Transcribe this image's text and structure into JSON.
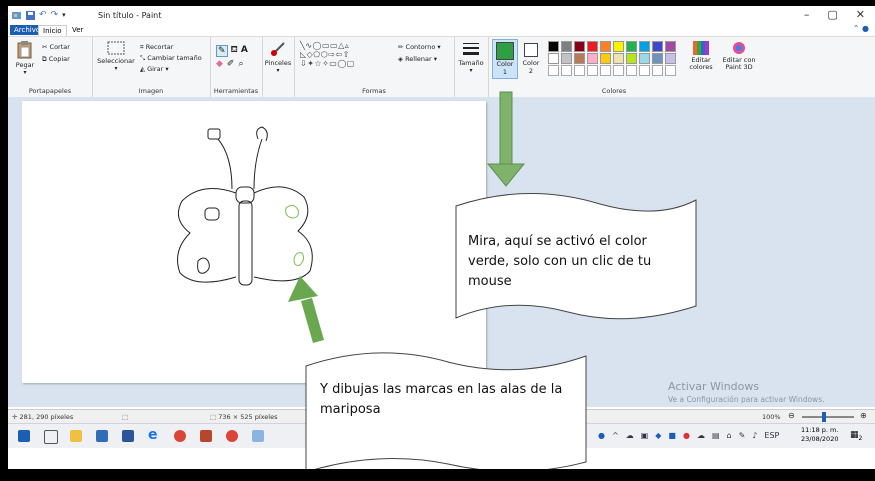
{
  "window": {
    "title": "Sin título - Paint",
    "minimize": "–",
    "maximize": "▢",
    "close": "✕"
  },
  "tabs": {
    "file": "Archivo",
    "home": "Inicio",
    "view": "Ver"
  },
  "ribbon": {
    "clipboard": {
      "paste": "Pegar",
      "cut": "Cortar",
      "copy": "Copiar",
      "label": "Portapapeles"
    },
    "image": {
      "select": "Seleccionar",
      "crop": "Recortar",
      "resize": "Cambiar tamaño",
      "rotate": "Girar ▾",
      "label": "Imagen"
    },
    "tools": {
      "label": "Herramientas",
      "text_tool": "A"
    },
    "brushes": {
      "label": "Pinceles"
    },
    "shapes": {
      "outline": "Contorno ▾",
      "fill": "Rellenar ▾",
      "label": "Formas"
    },
    "size": {
      "label": "Tamaño"
    },
    "color1": {
      "label": "Color",
      "num": "1",
      "value": "#2ea043"
    },
    "color2": {
      "label": "Color",
      "num": "2",
      "value": "#ffffff"
    },
    "colors": {
      "label": "Colores",
      "row1": [
        "#000000",
        "#7f7f7f",
        "#880015",
        "#ed1c24",
        "#ff7f27",
        "#fff200",
        "#22b14c",
        "#00a2e8",
        "#3f48cc",
        "#a349a4"
      ],
      "row2": [
        "#ffffff",
        "#c3c3c3",
        "#b97a57",
        "#ffaec9",
        "#ffc90e",
        "#efe4b0",
        "#b5e61d",
        "#99d9ea",
        "#7092be",
        "#c8bfe7"
      ],
      "edit_colors": "Editar colores",
      "edit_paint3d": "Editar con Paint 3D"
    }
  },
  "watermark": {
    "line1": "Activar Windows",
    "line2": "Ve a Configuración para activar Windows."
  },
  "status": {
    "cursor": "281, 290 píxeles",
    "canvas_size": "736 × 525 píxeles",
    "zoom": "100%"
  },
  "taskbar": {
    "lang": "ESP",
    "time": "11:18 p. m.",
    "date": "23/08/2020",
    "notif": "2"
  },
  "callouts": {
    "top": "Mira, aquí se activó el color verde, solo con un clic de tu mouse",
    "bottom": "Y dibujas las marcas en las alas de la mariposa"
  }
}
